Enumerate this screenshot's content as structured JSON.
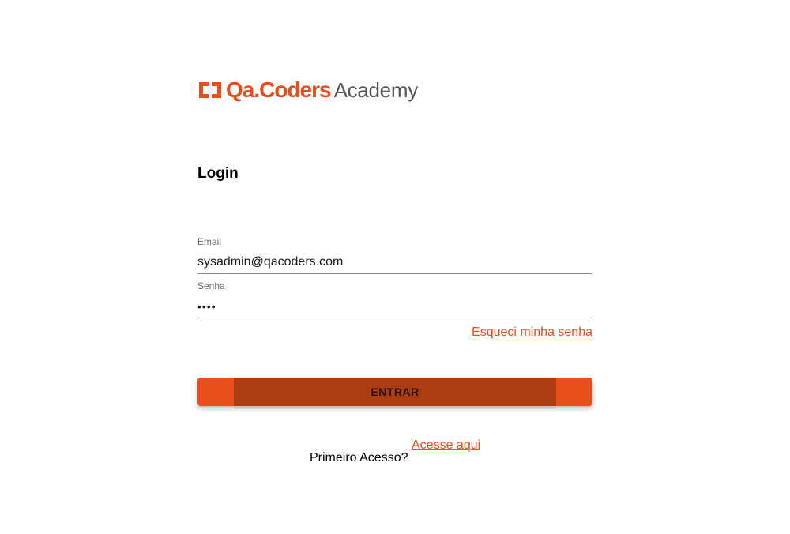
{
  "brand": {
    "name": "Qa.Coders",
    "subtitle": "Academy",
    "logo_icon": "qacoders-logo-icon",
    "accent_color": "#e84e1b",
    "accent_dark": "#ab3d11"
  },
  "login": {
    "title": "Login",
    "email": {
      "label": "Email",
      "value": "sysadmin@qacoders.com"
    },
    "senha": {
      "label": "Senha",
      "value": "1234"
    },
    "forgot_link": "Esqueci minha senha",
    "submit_label": "ENTRAR",
    "first_access_text": "Primeiro Acesso?",
    "first_access_link": "Acesse aqui"
  }
}
